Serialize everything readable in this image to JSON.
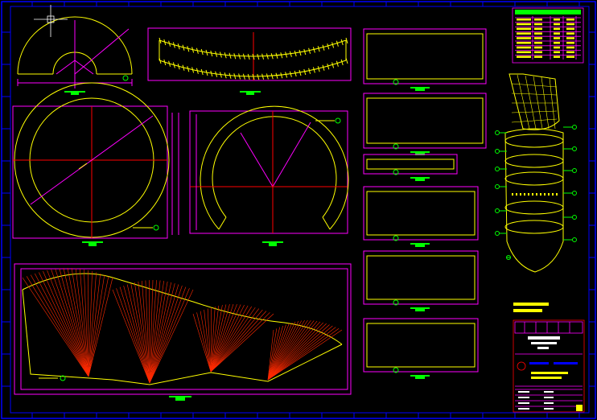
{
  "window": {
    "title": ""
  },
  "colors": {
    "background": "#000000",
    "frame": "#0000ff",
    "outline": "#ffff00",
    "dimension": "#ff00ff",
    "centerline": "#ff0000",
    "highlight": "#00ff00",
    "text": "#ffffff"
  },
  "drawing": {
    "views": [
      {
        "name": "half-ring-view",
        "icon": "arc-icon"
      },
      {
        "name": "conical-band-view",
        "icon": "band-icon"
      },
      {
        "name": "full-ring-view",
        "icon": "circle-icon"
      },
      {
        "name": "partial-ring-view",
        "icon": "circle-icon"
      },
      {
        "name": "flat-pattern-view",
        "icon": "fan-pattern-icon"
      },
      {
        "name": "plate-detail-views",
        "icon": "rectangle-icon"
      },
      {
        "name": "cyclone-assembly-view",
        "icon": "cyclone-icon"
      }
    ],
    "title_block": {
      "present": true,
      "legible_text": ""
    },
    "parts_list": {
      "present": true,
      "legible_text": ""
    }
  },
  "cursor": {
    "type": "crosshair-icon"
  }
}
